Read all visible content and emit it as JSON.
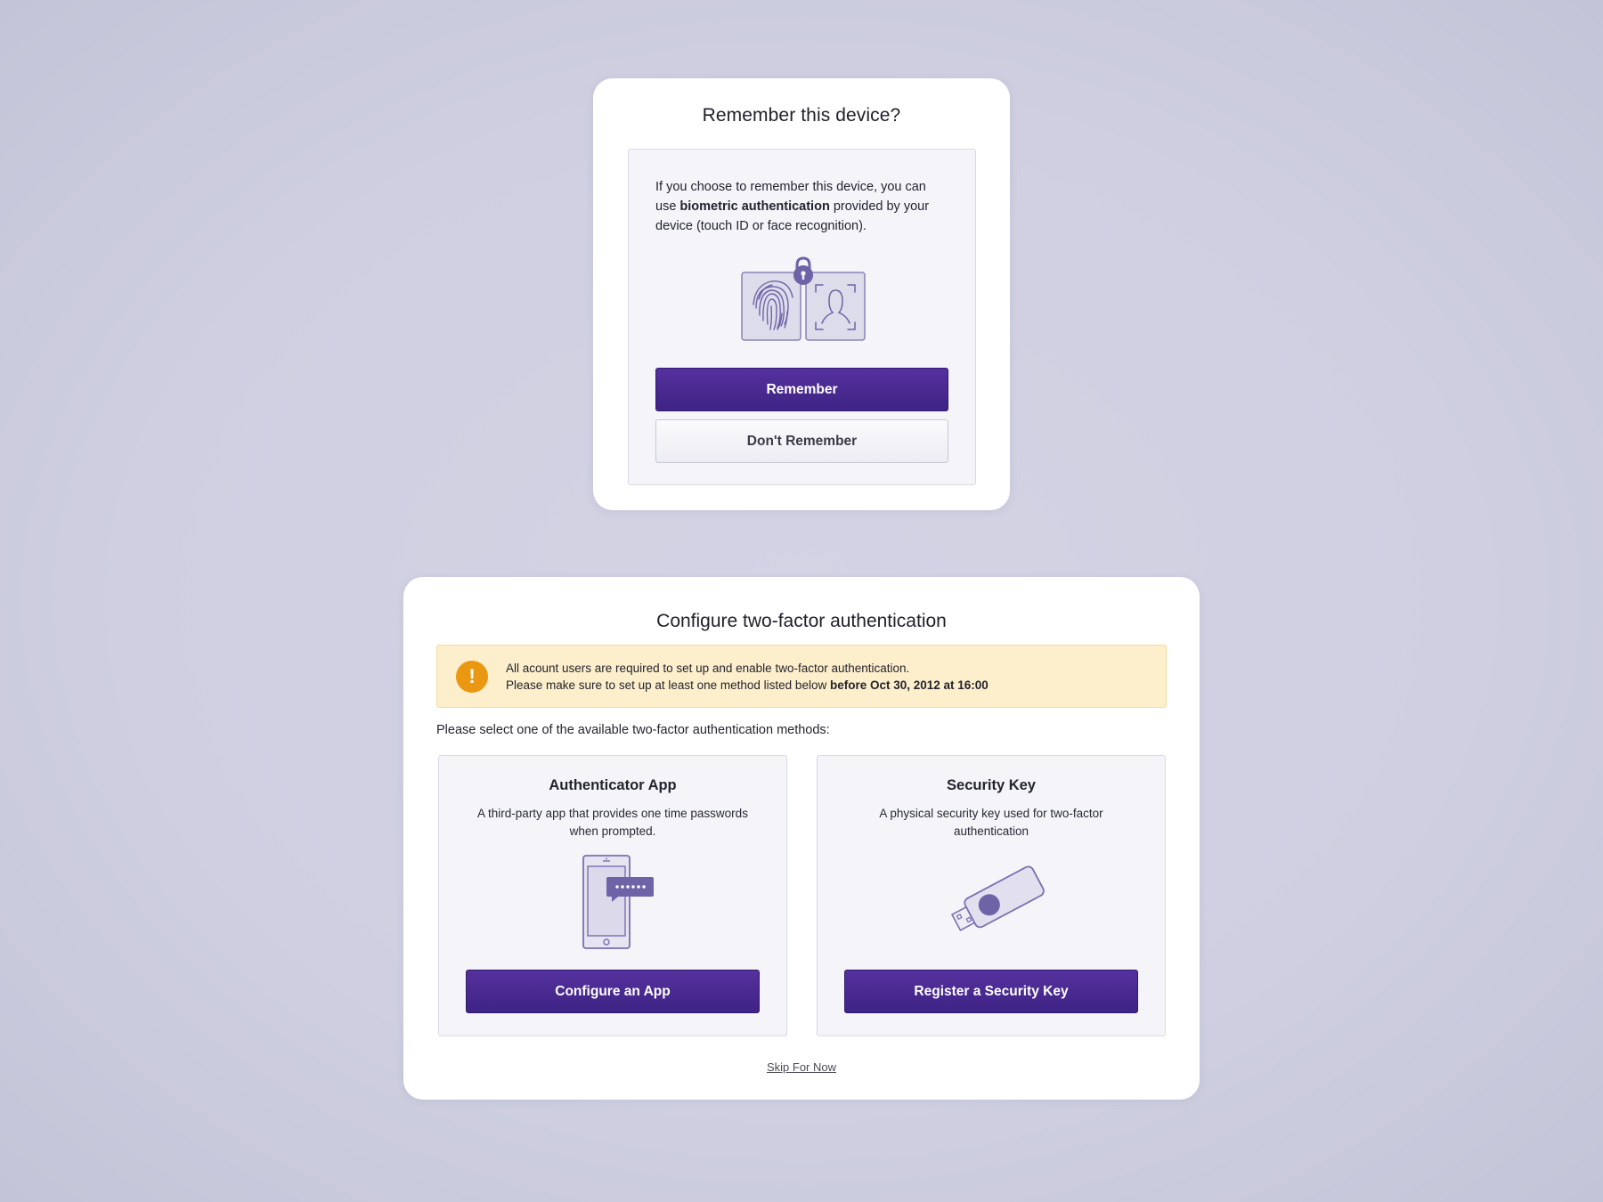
{
  "remember_card": {
    "title": "Remember this device?",
    "desc_pre": "If you choose to remember this device, you can use ",
    "desc_bold": "biometric authentication",
    "desc_post": " provided by your device (touch ID or face recognition).",
    "remember_label": "Remember",
    "dont_remember_label": "Don't Remember",
    "icons": [
      "fingerprint-icon",
      "lock-icon",
      "face-id-icon"
    ]
  },
  "twofa_card": {
    "title": "Configure two-factor authentication",
    "alert": {
      "icon": "exclamation-icon",
      "line1": "All acount users are required to set up and enable two-factor authentication.",
      "line2_pre": "Please make sure to set up at least one method listed below ",
      "line2_bold": "before Oct 30, 2012 at 16:00"
    },
    "prompt": "Please select one of the available two-factor authentication methods:",
    "methods": [
      {
        "title": "Authenticator App",
        "desc": "A third-party app that provides one time passwords when prompted.",
        "button": "Configure an App",
        "icon": "phone-otp-icon"
      },
      {
        "title": "Security Key",
        "desc": "A physical security key used for two-factor authentication",
        "button": "Register a Security Key",
        "icon": "usb-security-key-icon"
      }
    ],
    "skip_label": "Skip For Now"
  },
  "colors": {
    "primary": "#4a2a91",
    "warning": "#ea9712",
    "alert_bg": "#fdefcb",
    "illustration": "#6f63a8"
  }
}
